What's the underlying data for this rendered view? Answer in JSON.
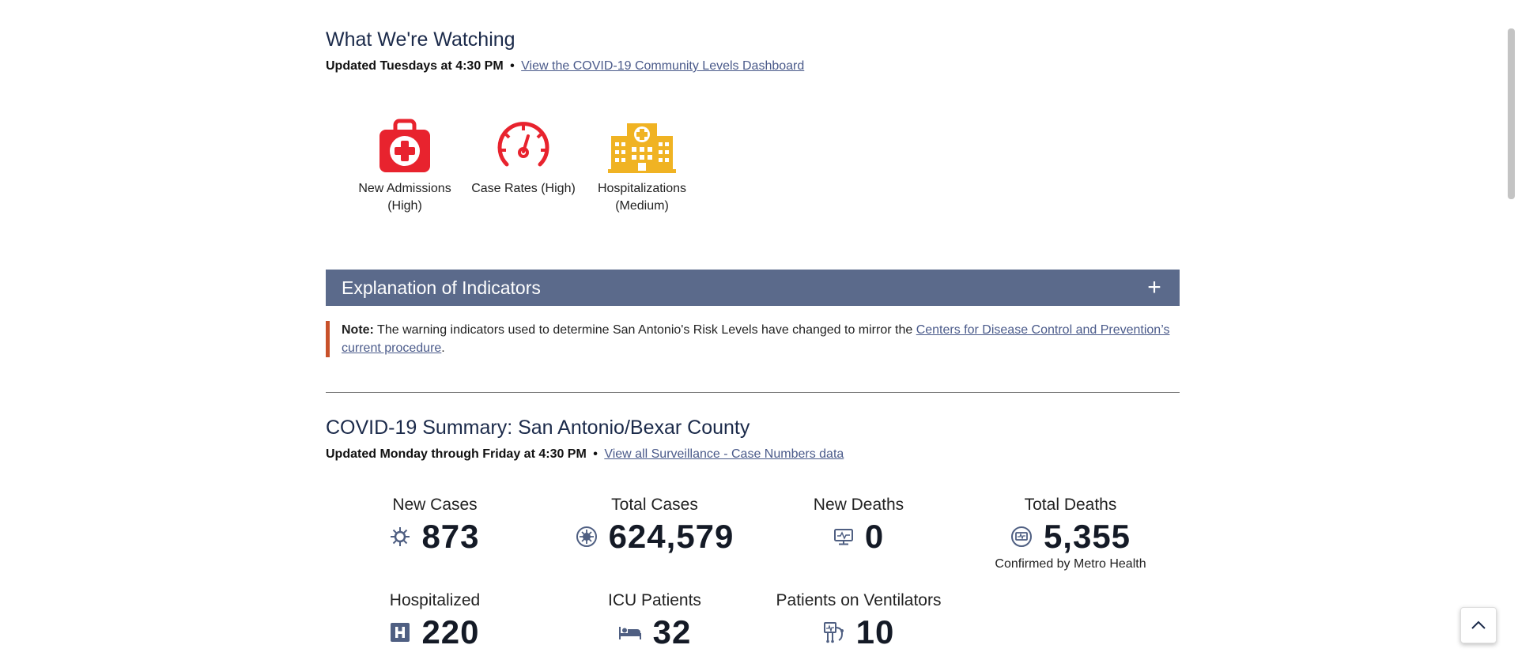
{
  "watching": {
    "title": "What We're Watching",
    "updated": "Updated Tuesdays at 4:30 PM",
    "separator": "•",
    "link": "View the COVID-19 Community Levels Dashboard",
    "indicators": [
      {
        "label": "New Admissions (High)",
        "icon": "first-aid-kit-icon",
        "color": "#e8232e"
      },
      {
        "label": "Case Rates (High)",
        "icon": "speedometer-icon",
        "color": "#e8232e"
      },
      {
        "label": "Hospitalizations (Medium)",
        "icon": "hospital-building-icon",
        "color": "#f0b323"
      }
    ]
  },
  "explanation": {
    "title": "Explanation of Indicators",
    "toggle": "+"
  },
  "note": {
    "label": "Note:",
    "text": " The warning indicators used to determine San Antonio's Risk Levels have changed to mirror the ",
    "link": "Centers for Disease Control and Prevention’s current procedure",
    "end": "."
  },
  "summary": {
    "title": "COVID-19 Summary: San Antonio/Bexar County",
    "updated": "Updated Monday through Friday at 4:30 PM",
    "separator": "•",
    "link": "View all Surveillance - Case Numbers data",
    "stats": {
      "new_cases": {
        "label": "New Cases",
        "value": "873",
        "icon": "virus-icon"
      },
      "total_cases": {
        "label": "Total Cases",
        "value": "624,579",
        "icon": "virus-circle-icon"
      },
      "new_deaths": {
        "label": "New Deaths",
        "value": "0",
        "icon": "monitor-icon"
      },
      "total_deaths": {
        "label": "Total Deaths",
        "value": "5,355",
        "icon": "monitor-circle-icon",
        "note": "Confirmed by Metro Health"
      },
      "hospitalized": {
        "label": "Hospitalized",
        "value": "220",
        "icon": "hospital-h-icon"
      },
      "icu": {
        "label": "ICU Patients",
        "value": "32",
        "icon": "hospital-bed-icon"
      },
      "ventilators": {
        "label": "Patients on Ventilators",
        "value": "10",
        "icon": "ventilator-icon"
      }
    }
  },
  "colors": {
    "heading": "#1b2a4a",
    "accordion": "#5b6a8b",
    "link": "#4a5a8a",
    "note_border": "#c8512a",
    "high": "#e8232e",
    "medium": "#f0b323",
    "stat_icon": "#4f5f82"
  }
}
